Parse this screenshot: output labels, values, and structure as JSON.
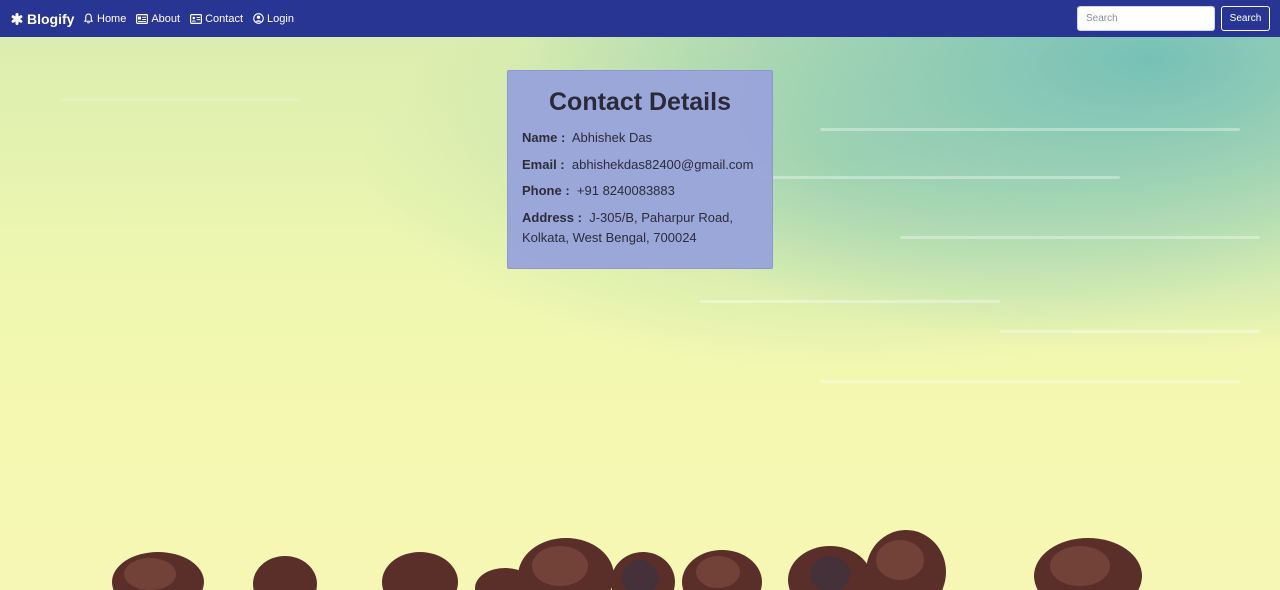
{
  "navbar": {
    "brand": "Blogify",
    "links": [
      {
        "label": "Home",
        "icon": "bell-icon"
      },
      {
        "label": "About",
        "icon": "id-card-icon"
      },
      {
        "label": "Contact",
        "icon": "address-card-icon"
      },
      {
        "label": "Login",
        "icon": "user-circle-icon"
      }
    ],
    "search_placeholder": "Search",
    "search_button": "Search",
    "brand_icon": "asterisk-icon",
    "bar_color": "#283593"
  },
  "contact": {
    "title": "Contact Details",
    "name_label": "Name :",
    "name_value": "Abhishek Das",
    "email_label": "Email :",
    "email_value": "abhishekdas82400@gmail.com",
    "phone_label": "Phone :",
    "phone_value": "+91 8240083883",
    "address_label": "Address :",
    "address_value": "J-305/B, Paharpur Road, Kolkata, West Bengal, 700024",
    "card_color": "#9aa4da"
  }
}
